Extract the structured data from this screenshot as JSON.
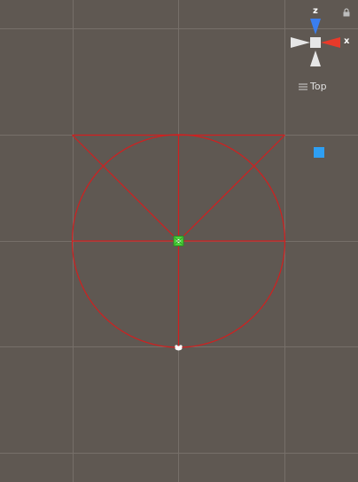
{
  "scene": {
    "view_mode": "Top",
    "gizmo": {
      "axis_z_label": "z",
      "axis_x_label": "x",
      "z_color": "#3a7ef0",
      "x_color": "#e83a2a",
      "neutral_color": "#e6e6e6"
    },
    "colors": {
      "background": "#5f5852",
      "grid": "#7a736d",
      "wire": "#d21f1f",
      "selection": "#4cd53b",
      "object_marker": "#2e9ff3"
    },
    "icons": [
      "lock-icon",
      "menu-icon",
      "pivot-handle-icon",
      "origin-marker-icon"
    ]
  }
}
